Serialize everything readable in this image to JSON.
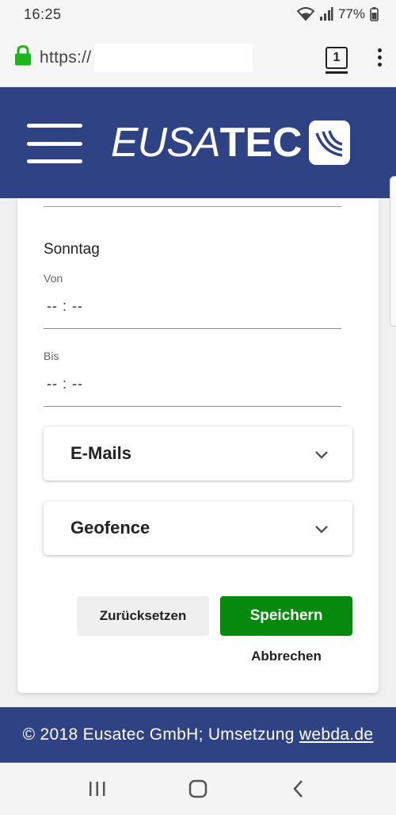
{
  "status_bar": {
    "time": "16:25",
    "battery": "77%",
    "icons": [
      "wifi-icon",
      "signal-icon",
      "battery-icon"
    ]
  },
  "browser": {
    "url_prefix": "https://",
    "tab_count": "1",
    "icons": [
      "lock-icon",
      "tabs-icon",
      "overflow-menu-icon"
    ],
    "lock_color": "#1db41d"
  },
  "header": {
    "brand_italic": "EUSA",
    "brand_bold": "TEC",
    "background": "#2f4283",
    "icons": [
      "hamburger-menu-icon",
      "eusatec-logo-icon"
    ]
  },
  "form": {
    "day": "Sonntag",
    "from_label": "Von",
    "from_value": "-- : --",
    "to_label": "Bis",
    "to_value": "-- : --",
    "panels": [
      {
        "title": "E-Mails"
      },
      {
        "title": "Geofence"
      }
    ],
    "reset_label": "Zurücksetzen",
    "save_label": "Speichern",
    "cancel_label": "Abbrechen",
    "save_color": "#068a0e"
  },
  "footer": {
    "text": "© 2018 Eusatec GmbH; Umsetzung ",
    "link": "webda.de"
  },
  "nav_bar": {
    "icons": [
      "recent-apps-icon",
      "home-icon",
      "back-icon"
    ]
  }
}
